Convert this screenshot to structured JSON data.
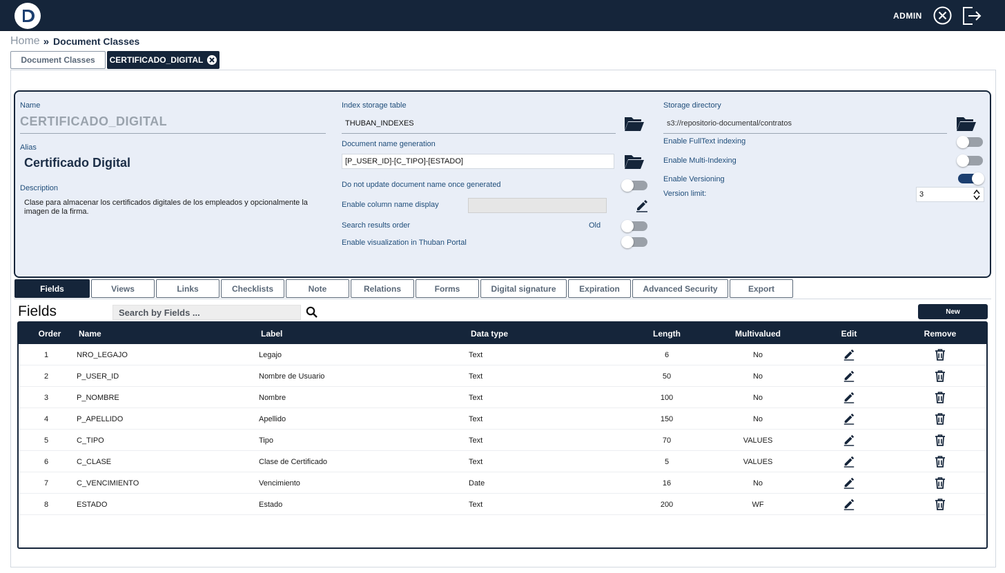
{
  "header": {
    "user": "ADMIN",
    "close_icon": "close-circle-icon",
    "logout_icon": "logout-icon",
    "logo_icon": "brand-logo-icon"
  },
  "breadcrumb": {
    "home": "Home",
    "separator": "»",
    "current": "Document Classes"
  },
  "page_tabs": [
    {
      "label": "Document Classes",
      "active": false
    },
    {
      "label": "CERTIFICADO_DIGITAL",
      "active": true
    }
  ],
  "props": {
    "name_label": "Name",
    "name_value": "CERTIFICADO_DIGITAL",
    "alias_label": "Alias",
    "alias_value": "Certificado Digital",
    "description_label": "Description",
    "description_value": "Clase para almacenar los certificados digitales de los empleados y opcionalmente la imagen de la firma.",
    "index_table_label": "Index storage table",
    "index_table_value": "THUBAN_INDEXES",
    "docname_gen_label": "Document name generation",
    "docname_gen_value": "[P_USER_ID]-[C_TIPO]-[ESTADO]",
    "no_update_label": "Do not update document name once generated",
    "column_display_label": "Enable column name display",
    "search_order_label": "Search results order",
    "search_order_value": "Old",
    "portal_label": "Enable visualization in Thuban Portal",
    "storage_dir_label": "Storage directory",
    "storage_dir_value": "s3://repositorio-documental/contratos",
    "fulltext_label": "Enable FullText indexing",
    "multi_index_label": "Enable Multi-Indexing",
    "versioning_label": "Enable Versioning",
    "version_limit_label": "Version limit:",
    "version_limit_value": "3",
    "toggles": {
      "no_update": false,
      "search_order": false,
      "portal": false,
      "fulltext": false,
      "multi_index": false,
      "versioning": true
    }
  },
  "section_tabs": [
    "Fields",
    "Views",
    "Links",
    "Checklists",
    "Note",
    "Relations",
    "Forms",
    "Digital signature",
    "Expiration",
    "Advanced Security",
    "Export"
  ],
  "fields": {
    "title": "Fields",
    "search_placeholder": "Search by Fields ...",
    "new_label": "New",
    "columns": [
      "Order",
      "Name",
      "Label",
      "Data type",
      "Length",
      "Multivalued",
      "Edit",
      "Remove"
    ],
    "rows": [
      {
        "order": "1",
        "name": "NRO_LEGAJO",
        "label": "Legajo",
        "type": "Text",
        "length": "6",
        "multi": "No"
      },
      {
        "order": "2",
        "name": "P_USER_ID",
        "label": "Nombre de Usuario",
        "type": "Text",
        "length": "50",
        "multi": "No"
      },
      {
        "order": "3",
        "name": "P_NOMBRE",
        "label": "Nombre",
        "type": "Text",
        "length": "100",
        "multi": "No"
      },
      {
        "order": "4",
        "name": "P_APELLIDO",
        "label": "Apellido",
        "type": "Text",
        "length": "150",
        "multi": "No"
      },
      {
        "order": "5",
        "name": "C_TIPO",
        "label": "Tipo",
        "type": "Text",
        "length": "70",
        "multi": "VALUES"
      },
      {
        "order": "6",
        "name": "C_CLASE",
        "label": "Clase de Certificado",
        "type": "Text",
        "length": "5",
        "multi": "VALUES"
      },
      {
        "order": "7",
        "name": "C_VENCIMIENTO",
        "label": "Vencimiento",
        "type": "Date",
        "length": "16",
        "multi": "No"
      },
      {
        "order": "8",
        "name": "ESTADO",
        "label": "Estado",
        "type": "Text",
        "length": "200",
        "multi": "WF"
      }
    ]
  }
}
